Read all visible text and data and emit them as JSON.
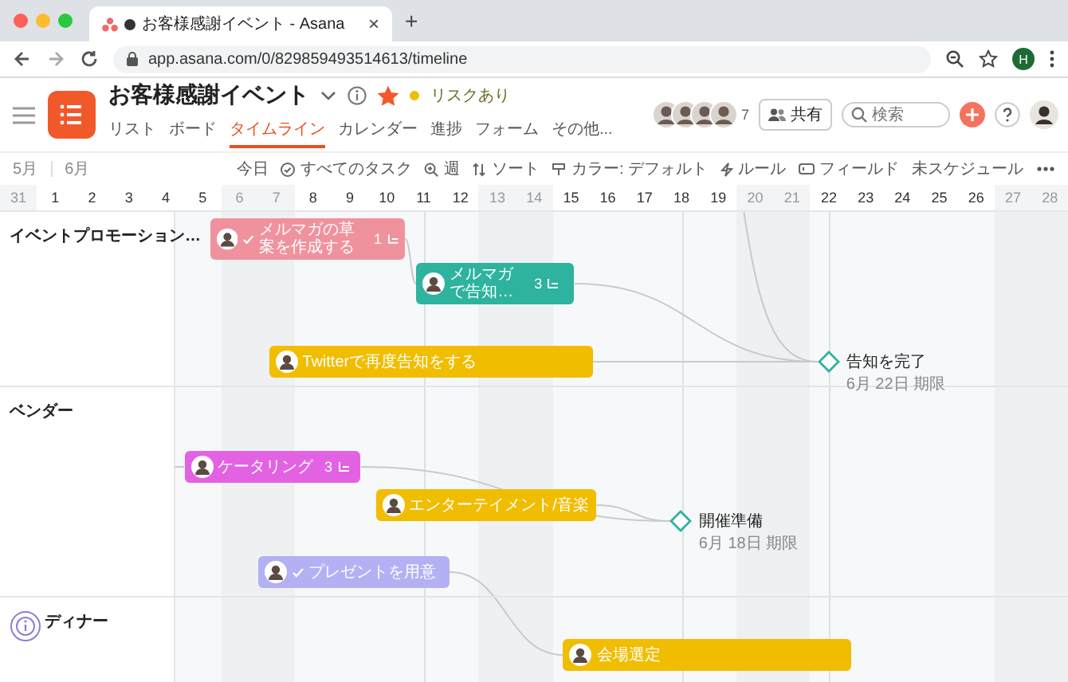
{
  "browser": {
    "tab_title": "お客様感謝イベント - Asana",
    "tab_close": "×",
    "new_tab": "+",
    "url": "app.asana.com/0/829859493514613/timeline",
    "profile_initial": "H"
  },
  "project": {
    "title": "お客様感謝イベント",
    "starred": true,
    "status": {
      "label": "リスクあり",
      "color": "#f1bd00"
    }
  },
  "tabs": [
    {
      "label": "リスト",
      "selected": false
    },
    {
      "label": "ボード",
      "selected": false
    },
    {
      "label": "タイムライン",
      "selected": true
    },
    {
      "label": "カレンダー",
      "selected": false
    },
    {
      "label": "進捗",
      "selected": false
    },
    {
      "label": "フォーム",
      "selected": false
    },
    {
      "label": "その他...",
      "selected": false
    }
  ],
  "members": {
    "extra_count": "7"
  },
  "share_button": "共有",
  "search": {
    "placeholder": "検索"
  },
  "toolbar": {
    "months": [
      "5月",
      "6月"
    ],
    "actions": [
      "今日",
      "すべてのタスク",
      "週",
      "ソート",
      "カラー: デフォルト",
      "ルール",
      "フィールド",
      "未スケジュール"
    ]
  },
  "dates": [
    {
      "label": "31",
      "weekend": true
    },
    {
      "label": "1",
      "weekend": false
    },
    {
      "label": "2",
      "weekend": false
    },
    {
      "label": "3",
      "weekend": false
    },
    {
      "label": "4",
      "weekend": false
    },
    {
      "label": "5",
      "weekend": false
    },
    {
      "label": "6",
      "weekend": true
    },
    {
      "label": "7",
      "weekend": true
    },
    {
      "label": "8",
      "weekend": false
    },
    {
      "label": "9",
      "weekend": false
    },
    {
      "label": "10",
      "weekend": false
    },
    {
      "label": "11",
      "weekend": false
    },
    {
      "label": "12",
      "weekend": false
    },
    {
      "label": "13",
      "weekend": true
    },
    {
      "label": "14",
      "weekend": true
    },
    {
      "label": "15",
      "weekend": false
    },
    {
      "label": "16",
      "weekend": false
    },
    {
      "label": "17",
      "weekend": false
    },
    {
      "label": "18",
      "weekend": false
    },
    {
      "label": "19",
      "weekend": false
    },
    {
      "label": "20",
      "weekend": true
    },
    {
      "label": "21",
      "weekend": true
    },
    {
      "label": "22",
      "weekend": false
    },
    {
      "label": "23",
      "weekend": false
    },
    {
      "label": "24",
      "weekend": false
    },
    {
      "label": "25",
      "weekend": false
    },
    {
      "label": "26",
      "weekend": false
    },
    {
      "label": "27",
      "weekend": true
    },
    {
      "label": "28",
      "weekend": true
    }
  ],
  "sections": [
    {
      "name": "イベントプロモーション…",
      "tasks": [
        {
          "name": "メルマガの草案を作成する",
          "color": "#f0929e",
          "completed": true,
          "subtask_count": "1"
        },
        {
          "name": "メルマガで告知…",
          "color": "#2db39e",
          "completed": false,
          "subtask_count": "3"
        },
        {
          "name": "Twitterで再度告知をする",
          "color": "#f1bd00",
          "completed": false
        }
      ],
      "milestone": {
        "name": "告知を完了",
        "due": "6月 22日 期限"
      }
    },
    {
      "name": "ベンダー",
      "tasks": [
        {
          "name": "ケータリング",
          "color": "#e362e3",
          "completed": false,
          "subtask_count": "3"
        },
        {
          "name": "エンターテイメント/音楽",
          "color": "#f1bd00",
          "completed": false
        },
        {
          "name": "プレゼントを用意",
          "color": "#b3b1f3",
          "completed": true
        }
      ],
      "milestone": {
        "name": "開催準備",
        "due": "6月 18日 期限"
      }
    },
    {
      "name": "ディナー",
      "tasks": [
        {
          "name": "会場選定",
          "color": "#f1bd00",
          "completed": false
        }
      ]
    }
  ]
}
